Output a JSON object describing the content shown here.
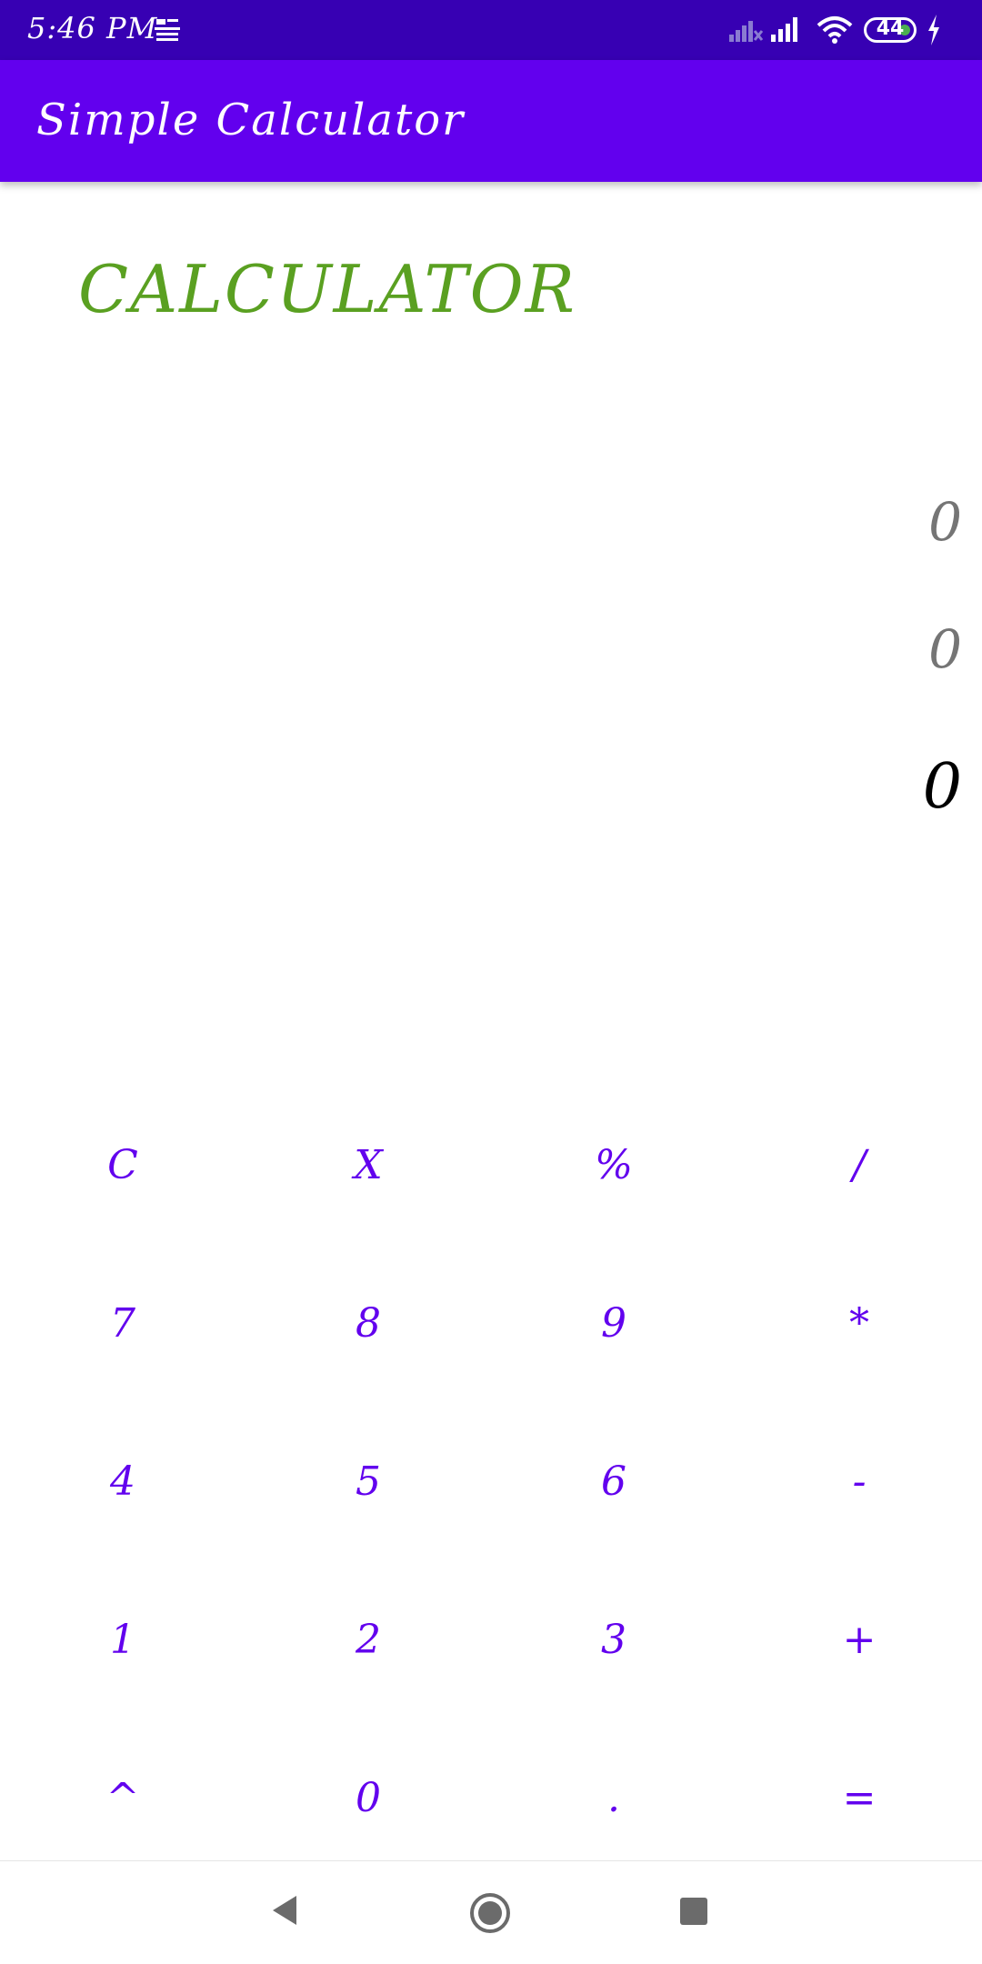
{
  "status_bar": {
    "time": "5:46 PM",
    "battery_level": "44",
    "news_icon": "news-app-icon",
    "signal_icons": [
      "signal-no-service-icon",
      "signal-bars-icon"
    ],
    "wifi_icon": "wifi-icon",
    "charging_icon": "bolt-icon",
    "bg_color": "#3700b3"
  },
  "app_bar": {
    "title": "Simple Calculator",
    "bg_color": "#6200ee"
  },
  "content": {
    "heading": "CALCULATOR",
    "heading_color": "#5aa021",
    "display_lines": [
      "0",
      "0",
      "0"
    ]
  },
  "keypad": {
    "text_color": "#6200ee",
    "keys": [
      {
        "label": "C",
        "name": "key-clear"
      },
      {
        "label": "X",
        "name": "key-backspace"
      },
      {
        "label": "%",
        "name": "key-percent"
      },
      {
        "label": "/",
        "name": "key-divide"
      },
      {
        "label": "7",
        "name": "key-7"
      },
      {
        "label": "8",
        "name": "key-8"
      },
      {
        "label": "9",
        "name": "key-9"
      },
      {
        "label": "*",
        "name": "key-multiply"
      },
      {
        "label": "4",
        "name": "key-4"
      },
      {
        "label": "5",
        "name": "key-5"
      },
      {
        "label": "6",
        "name": "key-6"
      },
      {
        "label": "-",
        "name": "key-minus"
      },
      {
        "label": "1",
        "name": "key-1"
      },
      {
        "label": "2",
        "name": "key-2"
      },
      {
        "label": "3",
        "name": "key-3"
      },
      {
        "label": "+",
        "name": "key-plus"
      },
      {
        "label": "^",
        "name": "key-power"
      },
      {
        "label": "0",
        "name": "key-0"
      },
      {
        "label": ".",
        "name": "key-decimal"
      },
      {
        "label": "=",
        "name": "key-equals"
      }
    ]
  },
  "nav_bar": {
    "icons": [
      "back-icon",
      "home-icon",
      "recents-icon"
    ]
  }
}
